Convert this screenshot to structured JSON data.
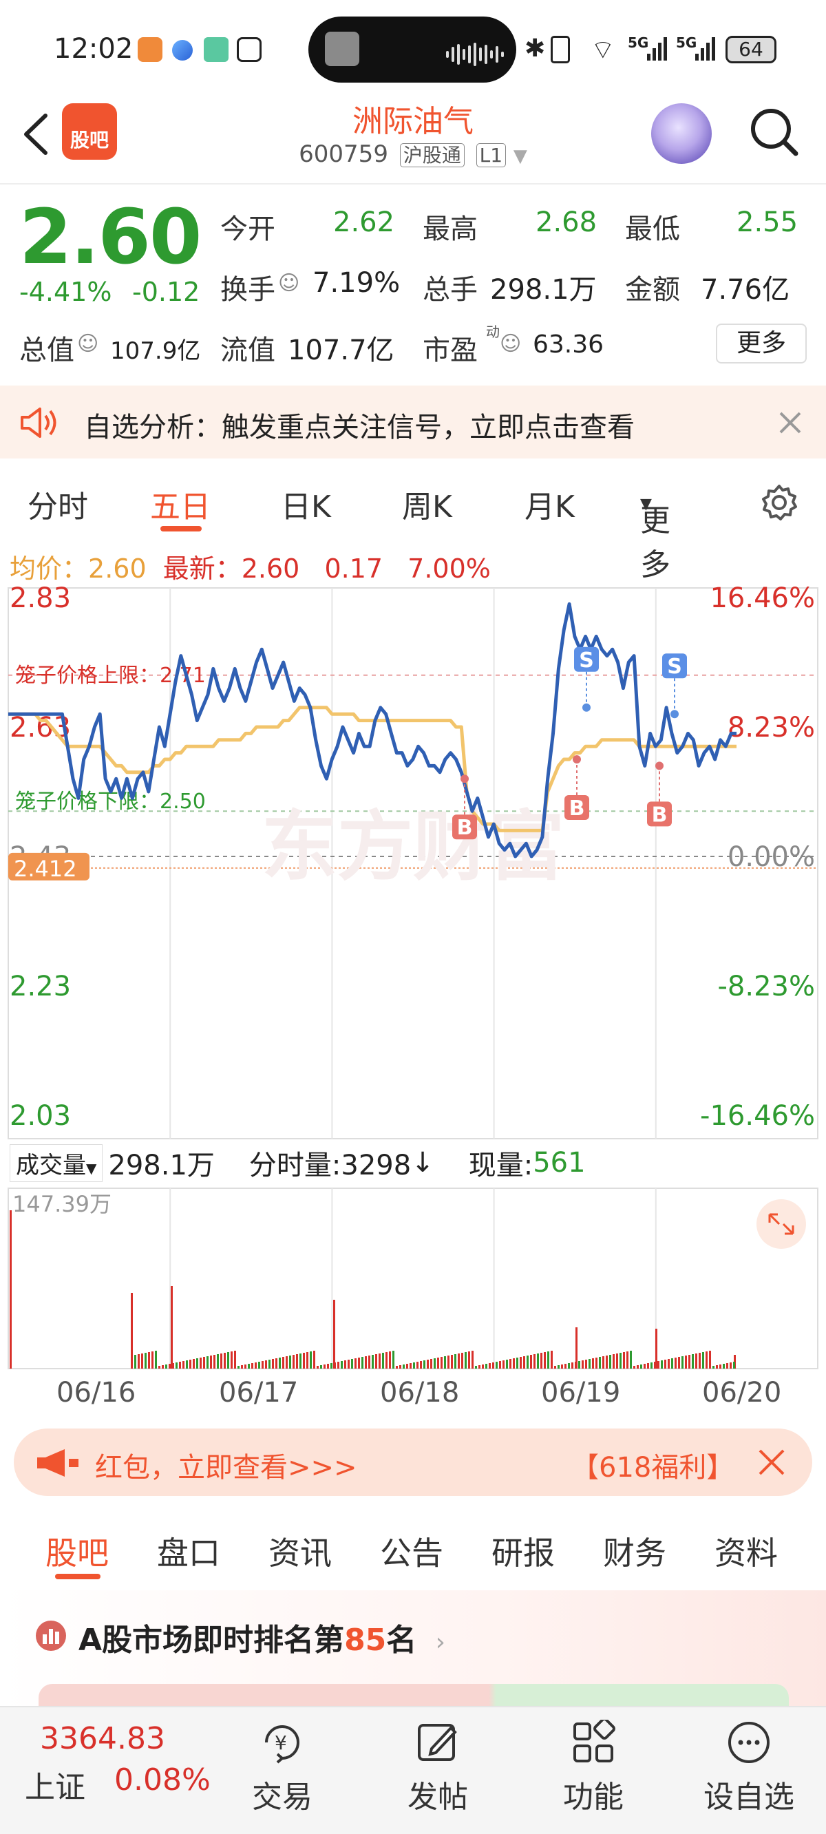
{
  "status_bar": {
    "time": "12:02",
    "battery": "64",
    "network_1": "5G",
    "network_2": "5G"
  },
  "header": {
    "logo_text": "股吧",
    "title": "洲际油气",
    "code": "600759",
    "exchange_tag": "沪股通",
    "level_tag": "L1"
  },
  "quote": {
    "price": "2.60",
    "change_pct": "-4.41%",
    "change": "-0.12",
    "open_label": "今开",
    "open": "2.62",
    "high_label": "最高",
    "high": "2.68",
    "low_label": "最低",
    "low": "2.55",
    "turnover_label": "换手",
    "turnover": "7.19%",
    "volume_label": "总手",
    "volume": "298.1万",
    "amount_label": "金额",
    "amount": "7.76亿",
    "mktcap_label": "总值",
    "mktcap": "107.9亿",
    "float_label": "流值",
    "float": "107.7亿",
    "pe_label": "市盈",
    "pe_sup": "动",
    "pe": "63.36",
    "more_button": "更多"
  },
  "banner": {
    "text": "自选分析：触发重点关注信号，立即点击查看"
  },
  "chart_tabs": {
    "items": [
      "分时",
      "五日",
      "日K",
      "周K",
      "月K",
      "更多"
    ],
    "active": "五日"
  },
  "price_info": {
    "avg_label": "均价：",
    "avg": "2.60",
    "latest_label": "最新：",
    "latest": "2.60",
    "change": "0.17",
    "pct": "7.00%"
  },
  "chart_labels": {
    "upper_limit": "笼子价格上限：2.71",
    "lower_limit": "笼子价格下限：2.50",
    "y_left": [
      "2.83",
      "2.63",
      "2.43",
      "2.23",
      "2.03"
    ],
    "y_right": [
      "16.46%",
      "8.23%",
      "0.00%",
      "-8.23%",
      "-16.46%"
    ],
    "ref_price": "2.412",
    "watermark": "东方财富"
  },
  "volume_bar": {
    "dropdown_label": "成交量",
    "total": "298.1万",
    "tick_label": "分时量:3298",
    "tick_arrow": "↓",
    "now_label": "现量:",
    "now": "561",
    "axis_max": "147.39万"
  },
  "dates": [
    "06/16",
    "06/17",
    "06/18",
    "06/19",
    "06/20"
  ],
  "promo": {
    "text": "红包，立即查看>>>",
    "tag": "【618福利】"
  },
  "bottom_tabs": {
    "items": [
      "股吧",
      "盘口",
      "资讯",
      "公告",
      "研报",
      "财务",
      "资料"
    ],
    "active": "股吧"
  },
  "rank": {
    "prefix": "A股市场即时排名第",
    "num": "85",
    "suffix": "名"
  },
  "bottom_nav": {
    "index_value": "3364.83",
    "index_name": "上证",
    "index_pct": "0.08%",
    "trade": "交易",
    "post": "发帖",
    "features": "功能",
    "watchlist": "设自选"
  },
  "chart_data": {
    "type": "line",
    "title": "",
    "x": [
      "06/16",
      "06/17",
      "06/18",
      "06/19",
      "06/20"
    ],
    "ylim": [
      2.03,
      2.83
    ],
    "y_ticks": [
      2.03,
      2.23,
      2.43,
      2.63,
      2.83
    ],
    "y_right_ticks": [
      "-16.46%",
      "-8.23%",
      "0.00%",
      "8.23%",
      "16.46%"
    ],
    "series": [
      {
        "color": "#2f5fb3",
        "values": [
          2.65,
          2.65,
          2.65,
          2.65,
          2.65,
          2.65,
          2.65,
          2.65,
          2.65,
          2.65,
          2.65,
          2.6,
          2.55,
          2.52,
          2.58,
          2.6,
          2.63,
          2.65,
          2.55,
          2.53,
          2.55,
          2.52,
          2.55,
          2.52,
          2.55,
          2.56,
          2.53,
          2.58,
          2.63,
          2.6,
          2.65,
          2.7,
          2.74,
          2.71,
          2.68,
          2.64,
          2.66,
          2.68,
          2.72,
          2.69,
          2.67,
          2.69,
          2.72,
          2.69,
          2.67,
          2.7,
          2.73,
          2.75,
          2.72,
          2.69,
          2.71,
          2.73,
          2.7,
          2.67,
          2.69,
          2.68,
          2.66,
          2.61,
          2.57,
          2.55,
          2.58,
          2.6,
          2.63,
          2.61,
          2.59,
          2.62,
          2.6,
          2.6,
          2.64,
          2.66,
          2.65,
          2.62,
          2.59,
          2.59,
          2.57,
          2.58,
          2.6,
          2.59,
          2.57,
          2.57,
          2.56,
          2.58,
          2.59,
          2.58,
          2.56,
          2.53,
          2.5,
          2.52,
          2.49,
          2.46,
          2.48,
          2.45,
          2.44,
          2.45,
          2.43,
          2.44,
          2.45,
          2.43,
          2.44,
          2.46,
          2.55,
          2.62,
          2.72,
          2.78,
          2.82,
          2.77,
          2.75,
          2.77,
          2.75,
          2.77,
          2.75,
          2.74,
          2.75,
          2.73,
          2.69,
          2.73,
          2.74,
          2.6,
          2.57,
          2.62,
          2.6,
          2.61,
          2.66,
          2.62,
          2.59,
          2.6,
          2.62,
          2.61,
          2.57,
          2.59,
          2.6,
          2.58,
          2.61,
          2.6,
          2.62,
          2.62
        ]
      },
      {
        "color": "#f2c46b",
        "values": [
          2.65,
          2.65,
          2.65,
          2.65,
          2.65,
          2.65,
          2.64,
          2.64,
          2.63,
          2.62,
          2.61,
          2.6,
          2.6,
          2.6,
          2.6,
          2.6,
          2.6,
          2.6,
          2.59,
          2.58,
          2.57,
          2.57,
          2.56,
          2.56,
          2.56,
          2.56,
          2.56,
          2.57,
          2.57,
          2.58,
          2.58,
          2.59,
          2.59,
          2.6,
          2.6,
          2.6,
          2.6,
          2.6,
          2.6,
          2.61,
          2.61,
          2.61,
          2.61,
          2.61,
          2.62,
          2.62,
          2.63,
          2.63,
          2.63,
          2.63,
          2.63,
          2.64,
          2.64,
          2.65,
          2.66,
          2.66,
          2.66,
          2.66,
          2.66,
          2.66,
          2.65,
          2.65,
          2.65,
          2.65,
          2.65,
          2.64,
          2.64,
          2.64,
          2.64,
          2.64,
          2.64,
          2.64,
          2.64,
          2.64,
          2.64,
          2.64,
          2.64,
          2.64,
          2.64,
          2.64,
          2.64,
          2.64,
          2.64,
          2.63,
          2.63,
          2.53,
          2.5,
          2.49,
          2.48,
          2.48,
          2.48,
          2.47,
          2.47,
          2.47,
          2.47,
          2.47,
          2.47,
          2.47,
          2.47,
          2.47,
          2.53,
          2.55,
          2.57,
          2.58,
          2.58,
          2.59,
          2.59,
          2.6,
          2.6,
          2.6,
          2.61,
          2.61,
          2.61,
          2.61,
          2.61,
          2.61,
          2.61,
          2.6,
          2.6,
          2.6,
          2.6,
          2.6,
          2.6,
          2.6,
          2.6,
          2.6,
          2.6,
          2.6,
          2.6,
          2.6,
          2.6,
          2.6,
          2.6,
          2.6,
          2.6,
          2.6
        ]
      }
    ],
    "markers": [
      {
        "type": "B",
        "value": 2.55
      },
      {
        "type": "B",
        "value": 2.58
      },
      {
        "type": "S",
        "value": 2.66
      },
      {
        "type": "B",
        "value": 2.57
      },
      {
        "type": "S",
        "value": 2.65
      }
    ]
  }
}
